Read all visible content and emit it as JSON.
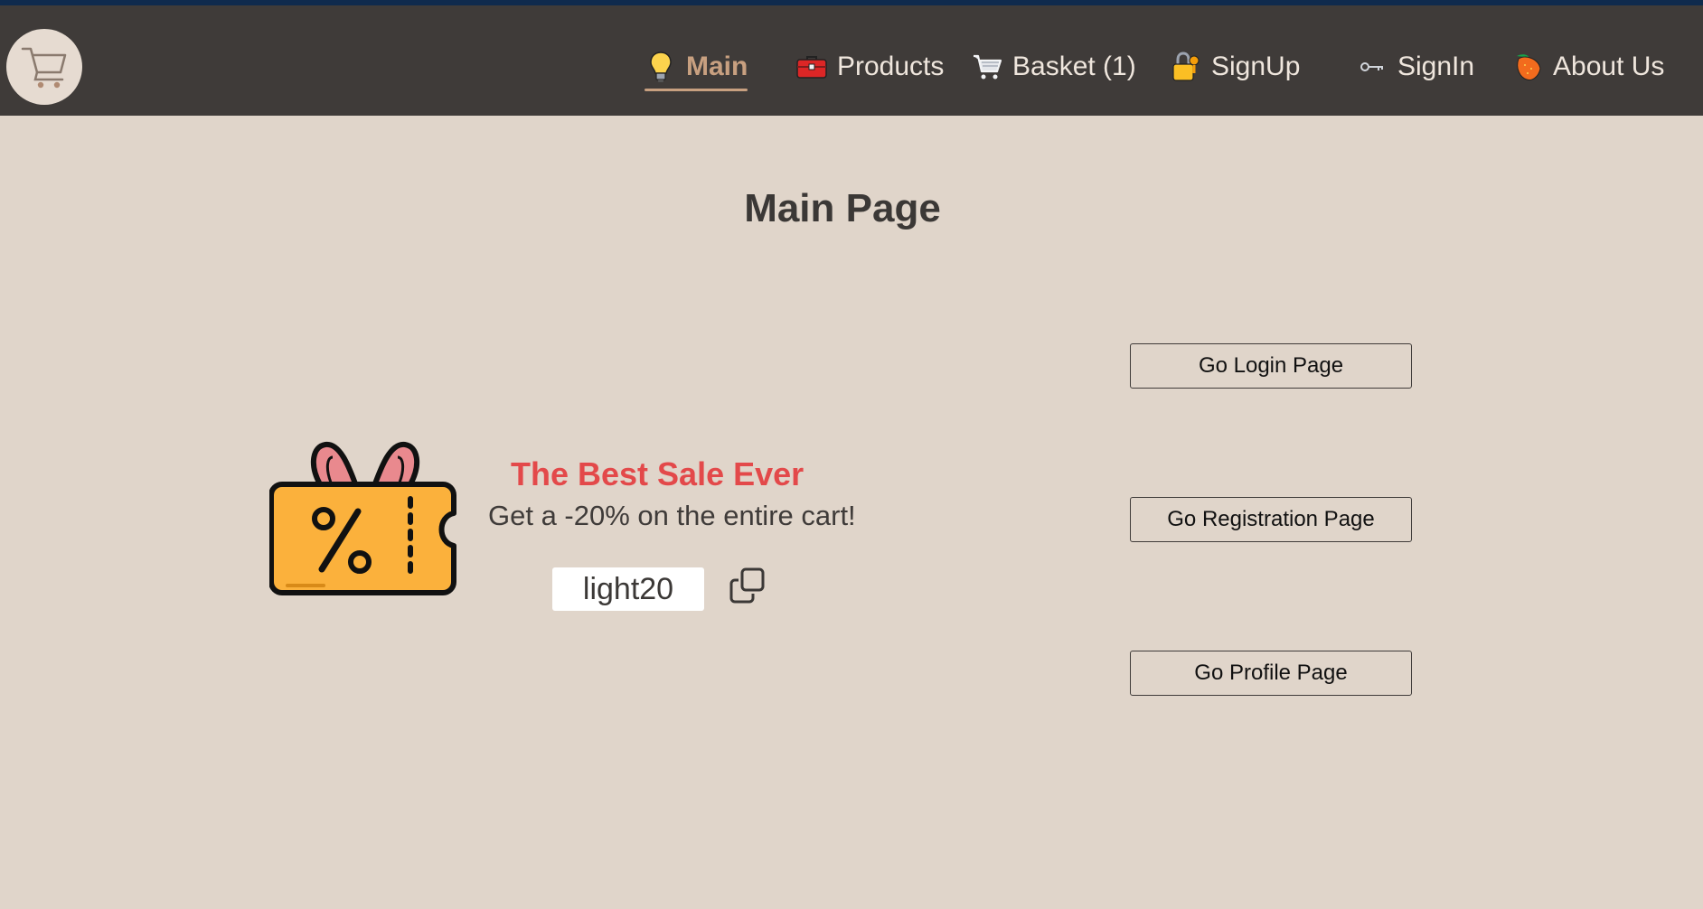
{
  "nav": {
    "items": [
      {
        "label": "Main",
        "icon": "lightbulb-icon",
        "active": true
      },
      {
        "label": "Products",
        "icon": "toolbox-icon"
      },
      {
        "label": "Basket (1)",
        "icon": "shopping-cart-icon"
      },
      {
        "label": "SignUp",
        "icon": "lock-key-icon"
      },
      {
        "label": "SignIn",
        "icon": "key-icon"
      },
      {
        "label": "About Us",
        "icon": "strawberry-icon"
      }
    ]
  },
  "main": {
    "title": "Main Page",
    "promo": {
      "title": "The Best Sale Ever",
      "subtitle": "Get a -20% on the entire cart!",
      "code": "light20"
    },
    "buttons": {
      "login": "Go Login Page",
      "registration": "Go Registration Page",
      "profile": "Go Profile Page"
    }
  },
  "colors": {
    "navbar": "#3f3b39",
    "page_background": "#e0d5ca",
    "active_nav": "#c8a080",
    "sale_title": "#e3494a"
  }
}
